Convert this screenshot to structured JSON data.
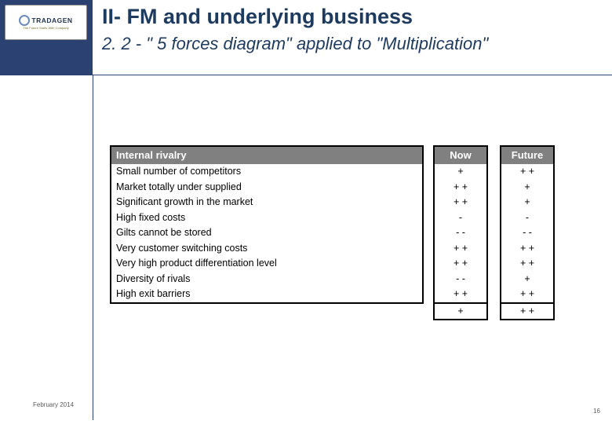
{
  "logo": {
    "brand": "TRADAGEN",
    "tagline": "The Future Starts With Company"
  },
  "header": {
    "title": "II-   FM and underlying business",
    "subtitle": "2. 2 - \" 5 forces diagram\" applied to \"Multiplication\""
  },
  "table": {
    "category_header": "Internal rivalry",
    "now_header": "Now",
    "future_header": "Future",
    "rows": [
      {
        "label": "Small number of competitors",
        "now": "+",
        "future": "+ +"
      },
      {
        "label": "Market totally under supplied",
        "now": "+ +",
        "future": "+"
      },
      {
        "label": "Significant growth in the market",
        "now": "+ +",
        "future": "+"
      },
      {
        "label": "High fixed costs",
        "now": "-",
        "future": "-"
      },
      {
        "label": "Gilts cannot be stored",
        "now": "- -",
        "future": "- -"
      },
      {
        "label": "Very customer switching costs",
        "now": "+ +",
        "future": "+ +"
      },
      {
        "label": "Very high product differentiation level",
        "now": "+ +",
        "future": "+ +"
      },
      {
        "label": "Diversity of rivals",
        "now": "- -",
        "future": "+"
      },
      {
        "label": "High exit barriers",
        "now": "+ +",
        "future": "+ +"
      }
    ],
    "totals": {
      "now": "+",
      "future": "+ +"
    }
  },
  "footer": {
    "date": "February 2014",
    "page": "16"
  }
}
